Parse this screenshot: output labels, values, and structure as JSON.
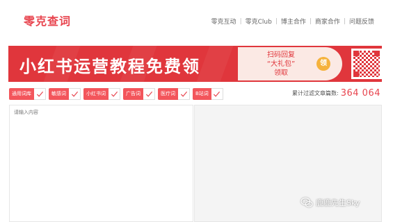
{
  "header": {
    "logo": "零克查词",
    "nav": [
      "零克互动",
      "零克Club",
      "博主合作",
      "商家合作",
      "问题反馈"
    ]
  },
  "banner": {
    "title": "小红书运营教程免费领",
    "cta_line1": "扫码回复",
    "cta_line2": "“大礼包”",
    "cta_line3": "领取",
    "badge": "领"
  },
  "filters": [
    {
      "label": "通用词库",
      "checked": true
    },
    {
      "label": "敏感词",
      "checked": true
    },
    {
      "label": "小红书词",
      "checked": true
    },
    {
      "label": "广告词",
      "checked": true
    },
    {
      "label": "医疗词",
      "checked": true
    },
    {
      "label": "B站词",
      "checked": true
    }
  ],
  "counter": {
    "label": "累计过滤文章篇数:",
    "value": "364 064"
  },
  "input": {
    "placeholder": "请输入内容"
  },
  "watermark": {
    "text": "鹿鹿先生Sky",
    "icon": "wechat-icon"
  },
  "colors": {
    "accent": "#e8454f",
    "banner": "#e0363c",
    "chip": "#f3555b"
  }
}
